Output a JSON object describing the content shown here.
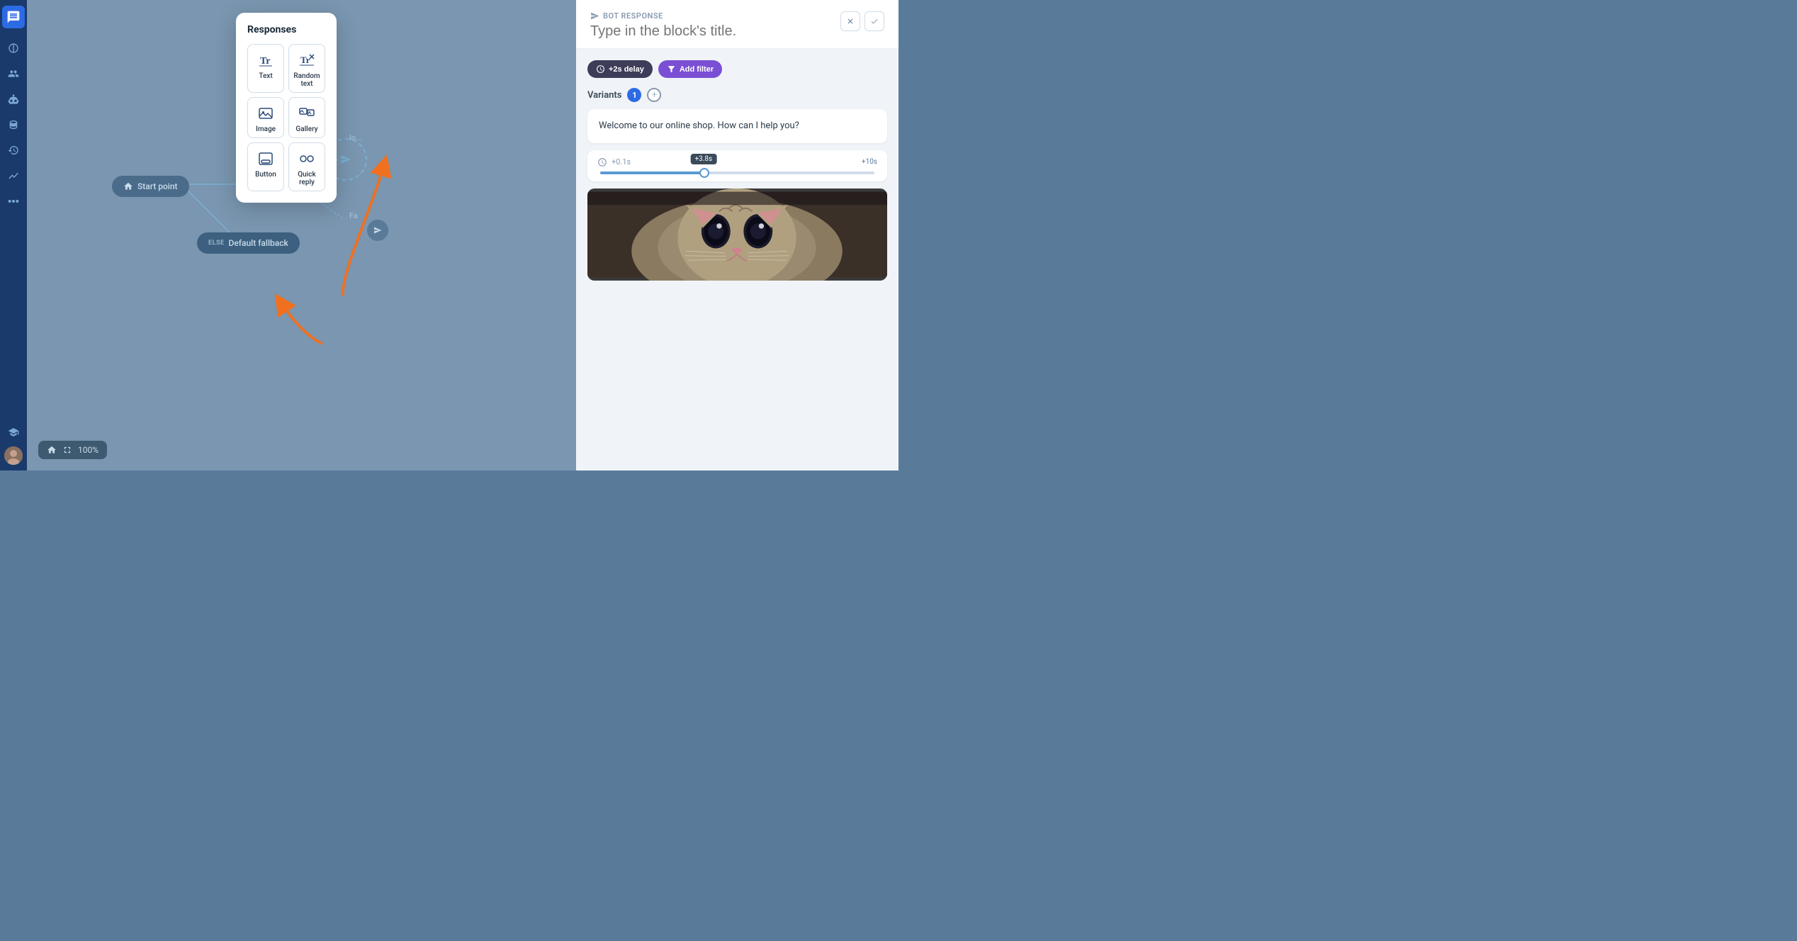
{
  "sidebar": {
    "logo_alt": "Chat logo",
    "items": [
      {
        "name": "organization",
        "icon": "org-icon"
      },
      {
        "name": "contacts",
        "icon": "contacts-icon"
      },
      {
        "name": "ai",
        "icon": "ai-icon"
      },
      {
        "name": "database",
        "icon": "database-icon"
      },
      {
        "name": "history",
        "icon": "history-icon"
      },
      {
        "name": "analytics",
        "icon": "analytics-icon"
      },
      {
        "name": "integrations",
        "icon": "integrations-icon"
      }
    ],
    "bottom": [
      {
        "name": "education",
        "icon": "education-icon"
      }
    ]
  },
  "canvas": {
    "nodes": [
      {
        "id": "start",
        "label": "Start point",
        "type": "start"
      },
      {
        "id": "fallback",
        "label": "Default fallback",
        "type": "fallback",
        "prefix": "ELSE"
      }
    ],
    "zoom": "100%"
  },
  "responses_popup": {
    "title": "Responses",
    "items": [
      {
        "id": "text",
        "label": "Text"
      },
      {
        "id": "random_text",
        "label": "Random text"
      },
      {
        "id": "image",
        "label": "Image"
      },
      {
        "id": "gallery",
        "label": "Gallery"
      },
      {
        "id": "button",
        "label": "Button"
      },
      {
        "id": "quick_reply",
        "label": "Quick reply"
      }
    ]
  },
  "bot_panel": {
    "label": "BOT RESPONSE",
    "title_placeholder": "Type in the block's title.",
    "close_label": "×",
    "check_label": "✓",
    "delay_btn": "+2s delay",
    "filter_btn": "Add filter",
    "variants_label": "Variants",
    "variants_count": "1",
    "message_text": "Welcome to our online shop. How can I help you?",
    "delay_min": "+0.1s",
    "delay_max": "+10s",
    "delay_current": "+3.8s"
  }
}
